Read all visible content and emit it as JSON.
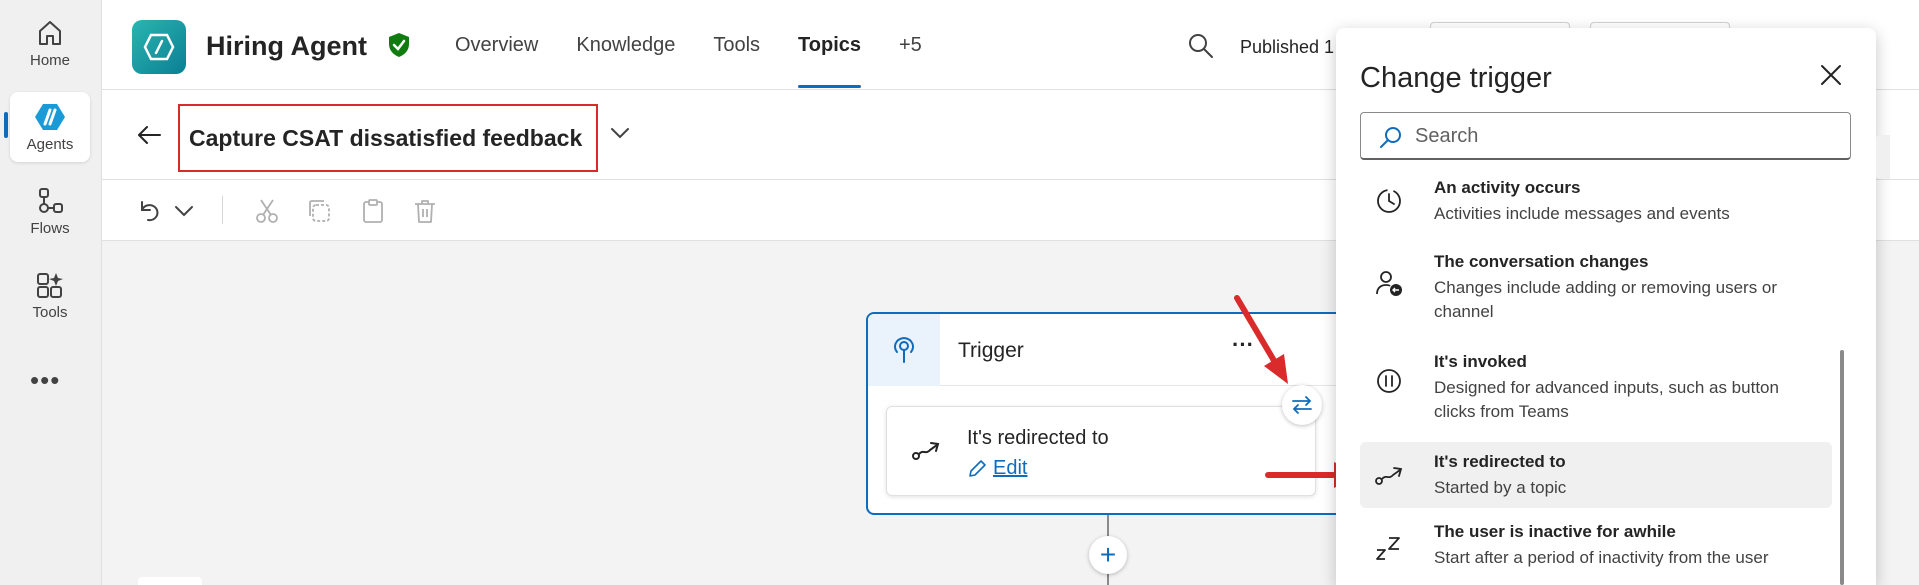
{
  "rail": {
    "items": [
      {
        "label": "Home",
        "icon": "home-icon"
      },
      {
        "label": "Agents",
        "icon": "agents-icon"
      },
      {
        "label": "Flows",
        "icon": "flows-icon"
      },
      {
        "label": "Tools",
        "icon": "tools-icon"
      }
    ],
    "more": "•••"
  },
  "header": {
    "app_name": "Hiring Agent",
    "tabs": [
      {
        "label": "Overview"
      },
      {
        "label": "Knowledge"
      },
      {
        "label": "Tools"
      },
      {
        "label": "Topics"
      },
      {
        "label": "+5"
      }
    ],
    "published": "Published 1"
  },
  "topic": {
    "title": "Capture CSAT dissatisfied feedback"
  },
  "canvas": {
    "trigger_label": "Trigger",
    "menu": "···",
    "node_title": "It's redirected to",
    "edit_label": "Edit",
    "add": "+"
  },
  "panel": {
    "title": "Change trigger",
    "search_placeholder": "Search",
    "triggers": [
      {
        "name": "An activity occurs",
        "desc": "Activities include messages and events",
        "icon": "clock-icon"
      },
      {
        "name": "The conversation changes",
        "desc": "Changes include adding or removing users or channel",
        "icon": "user-change-icon"
      },
      {
        "name": "It's invoked",
        "desc": "Designed for advanced inputs, such as button clicks from Teams",
        "icon": "pause-icon"
      },
      {
        "name": "It's redirected to",
        "desc": "Started by a topic",
        "icon": "redirect-icon"
      },
      {
        "name": "The user is inactive for awhile",
        "desc": "Start after a period of inactivity from the user",
        "icon": "sleep-icon"
      }
    ]
  },
  "colors": {
    "accent": "#0f6cbd",
    "highlight": "#d92b2b",
    "verified": "#107c10"
  }
}
